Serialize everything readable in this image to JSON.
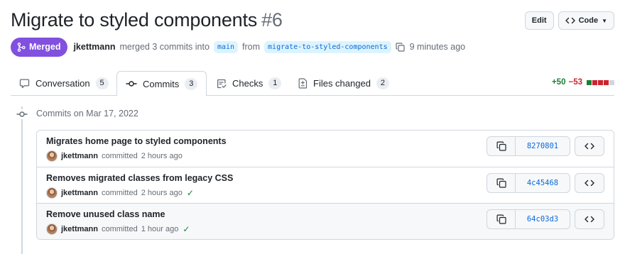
{
  "header": {
    "title": "Migrate to styled components",
    "number": "#6",
    "edit_label": "Edit",
    "code_label": "Code"
  },
  "meta": {
    "state": "Merged",
    "author": "jkettmann",
    "text_merged": "merged 3 commits into",
    "base_branch": "main",
    "text_from": "from",
    "head_branch": "migrate-to-styled-components",
    "time": "9 minutes ago"
  },
  "tabs": [
    {
      "label": "Conversation",
      "count": "5",
      "icon": "comment-icon"
    },
    {
      "label": "Commits",
      "count": "3",
      "icon": "commit-icon",
      "selected": true
    },
    {
      "label": "Checks",
      "count": "1",
      "icon": "checklist-icon"
    },
    {
      "label": "Files changed",
      "count": "2",
      "icon": "file-diff-icon"
    }
  ],
  "diffstat": {
    "additions": "+50",
    "deletions": "−53",
    "colors": [
      "#1a7f37",
      "#cf222e",
      "#cf222e",
      "#cf222e",
      "#d0d7de"
    ]
  },
  "timeline": {
    "date_label": "Commits on Mar 17, 2022"
  },
  "commits": [
    {
      "message": "Migrates home page to styled components",
      "author": "jkettmann",
      "action": "committed",
      "time": "2 hours ago",
      "checked": false,
      "sha": "8270801"
    },
    {
      "message": "Removes migrated classes from legacy CSS",
      "author": "jkettmann",
      "action": "committed",
      "time": "2 hours ago",
      "checked": true,
      "sha": "4c45468"
    },
    {
      "message": "Remove unused class name",
      "author": "jkettmann",
      "action": "committed",
      "time": "1 hour ago",
      "checked": true,
      "sha": "64c03d3"
    }
  ],
  "colors": {
    "merged": "#8250df",
    "link": "#0969da",
    "success": "#1a7f37",
    "danger": "#cf222e"
  }
}
